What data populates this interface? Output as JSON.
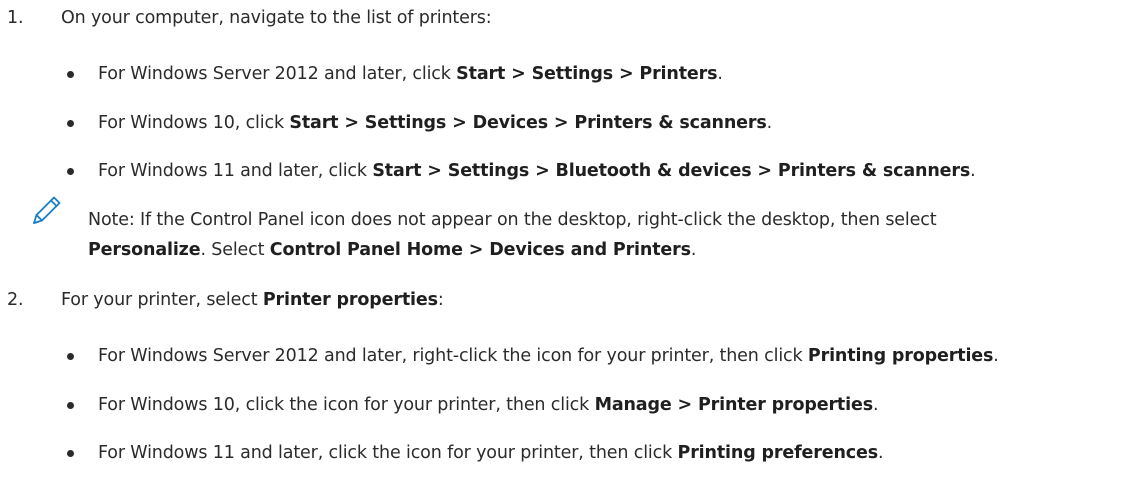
{
  "steps": [
    {
      "number": "1.",
      "text": "On your computer, navigate to the list of printers:",
      "bullets": [
        {
          "prefix": "For Windows Server 2012 and later, click ",
          "bold": "Start > Settings > Printers",
          "suffix": "."
        },
        {
          "prefix": "For Windows 10, click ",
          "bold": "Start > Settings > Devices > Printers & scanners",
          "suffix": "."
        },
        {
          "prefix": "For Windows 11 and later, click ",
          "bold": "Start > Settings > Bluetooth & devices > Printers & scanners",
          "suffix": "."
        }
      ]
    },
    {
      "number": "2.",
      "text_prefix": "For your printer, select ",
      "text_bold": "Printer properties",
      "text_suffix": ":",
      "bullets": [
        {
          "prefix": "For Windows Server 2012 and later, right-click the icon for your printer, then click ",
          "bold": "Printing properties",
          "suffix": "."
        },
        {
          "prefix": "For Windows 10, click the icon for your printer, then click ",
          "bold": "Manage > Printer properties",
          "suffix": "."
        },
        {
          "prefix": "For Windows 11 and later, click the icon for your printer, then click ",
          "bold": "Printing preferences",
          "suffix": "."
        }
      ]
    }
  ],
  "note": {
    "icon": "pencil-icon",
    "icon_color": "#1a7fc4",
    "line1": "Note: If the Control Panel icon does not appear on the desktop, right-click the desktop, then select",
    "line2_bold1": "Personalize",
    "line2_mid": ". Select ",
    "line2_bold2": "Control Panel Home > Devices and Printers",
    "line2_end": "."
  }
}
